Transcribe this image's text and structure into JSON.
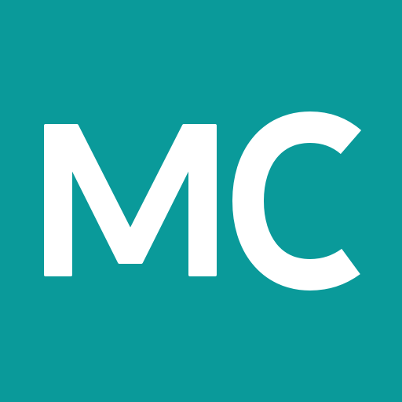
{
  "logo": {
    "monogram": "MC",
    "background_color": "#0a9a9a",
    "letter_color": "#ffffff"
  }
}
